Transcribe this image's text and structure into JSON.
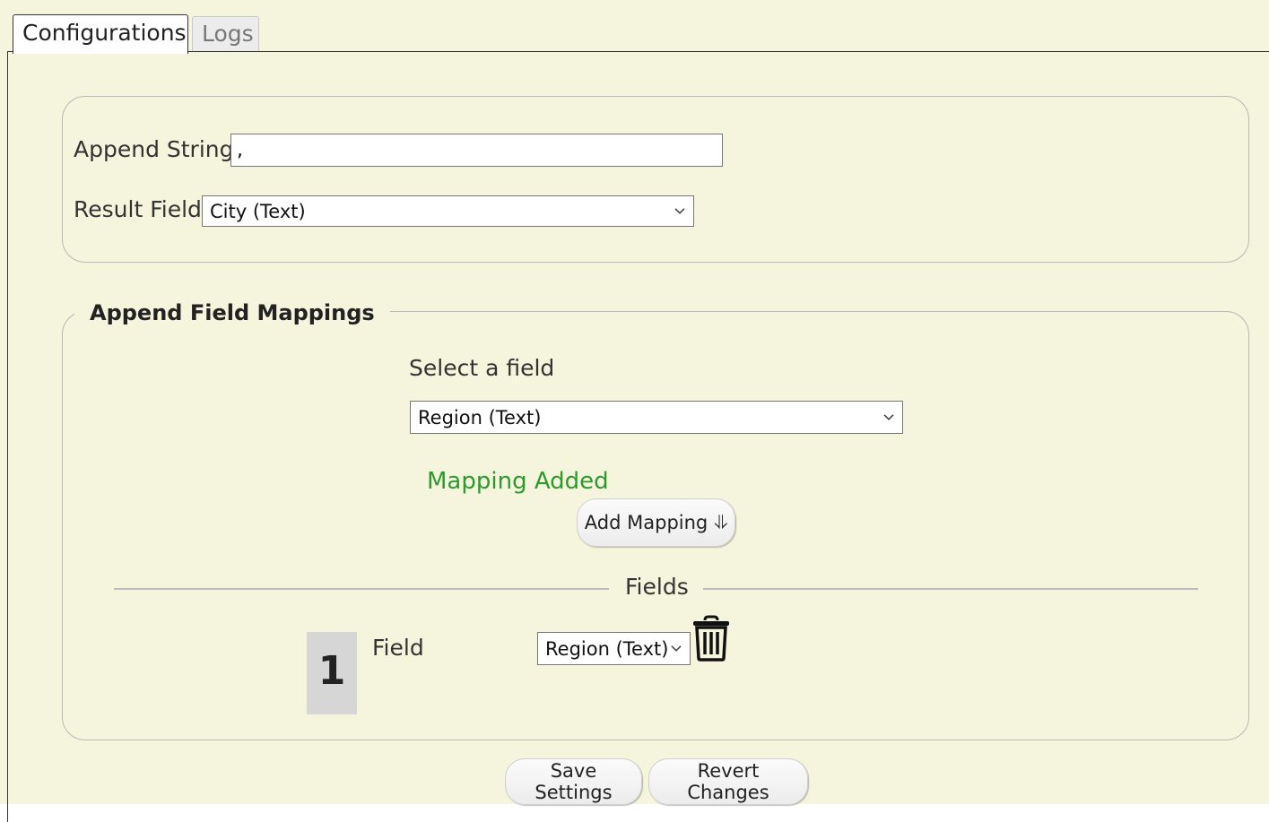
{
  "tabs": [
    {
      "label": "Configurations",
      "active": true
    },
    {
      "label": "Logs",
      "active": false
    }
  ],
  "settings": {
    "append_string_label": "Append String",
    "append_string_value": ",",
    "result_field_label": "Result Field",
    "result_field_value": "City (Text)"
  },
  "mappings": {
    "legend": "Append Field Mappings",
    "select_label": "Select a field",
    "select_value": "Region (Text)",
    "status": "Mapping Added",
    "add_button": "Add Mapping ⥥",
    "fields_divider": "Fields",
    "rows": [
      {
        "index": "1",
        "label": "Field",
        "value": "Region (Text)"
      }
    ]
  },
  "footer": {
    "save_button": "Save Settings",
    "revert_button": "Revert Changes"
  },
  "colors": {
    "background": "#f5f4dc",
    "status_text": "#2e9a2e"
  },
  "icons": {
    "select_arrow": "chevron-down-icon",
    "delete_row": "trash-icon"
  }
}
